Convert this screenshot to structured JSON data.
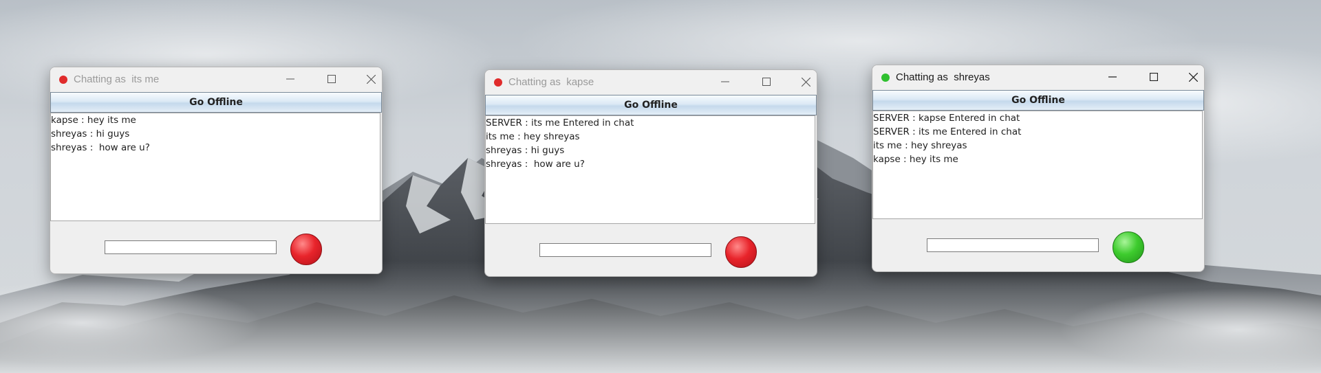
{
  "desktop": {
    "background": "misty snowy mountain wallpaper"
  },
  "windows": [
    {
      "title": "Chatting as  its me",
      "active": false,
      "status_color": "#e02b2b",
      "offline_button": "Go Offline",
      "messages": [
        "kapse : hey its me",
        "shreyas : hi guys",
        "shreyas :  how are u?"
      ],
      "input_value": "",
      "send_button_color": "#e8242b"
    },
    {
      "title": "Chatting as  kapse",
      "active": false,
      "status_color": "#e02b2b",
      "offline_button": "Go Offline",
      "messages": [
        "SERVER : its me Entered in chat",
        "its me : hey shreyas",
        "shreyas : hi guys",
        "shreyas :  how are u?"
      ],
      "input_value": "",
      "send_button_color": "#e8242b"
    },
    {
      "title": "Chatting as  shreyas",
      "active": true,
      "status_color": "#2fc02f",
      "offline_button": "Go Offline",
      "messages": [
        "SERVER : kapse Entered in chat",
        "SERVER : its me Entered in chat",
        "its me : hey shreyas",
        "kapse : hey its me"
      ],
      "input_value": "",
      "send_button_color": "#3ecc2e"
    }
  ],
  "icons": [
    "minimize-icon",
    "maximize-icon",
    "close-icon",
    "status-dot-icon"
  ]
}
